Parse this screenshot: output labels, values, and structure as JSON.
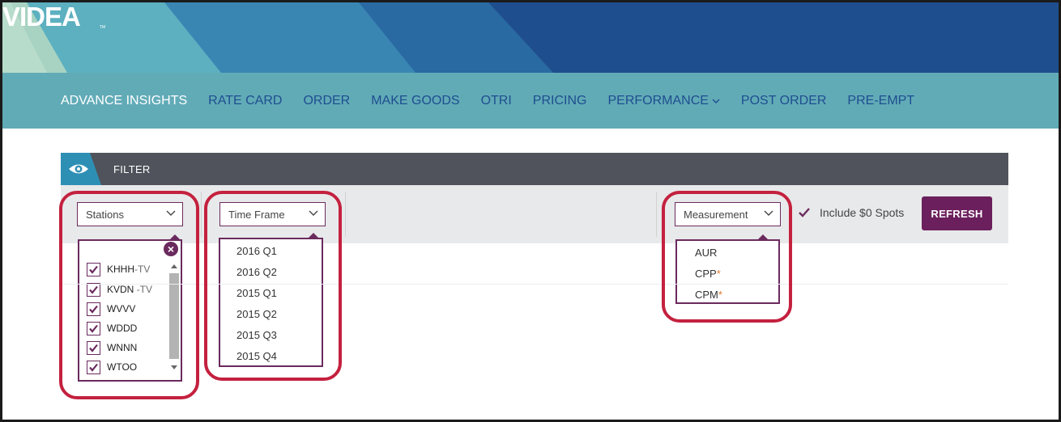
{
  "brand": {
    "logo_text": "VIDEA",
    "trademark": "TM"
  },
  "nav": {
    "items": [
      {
        "label": "ADVANCE INSIGHTS",
        "active": true
      },
      {
        "label": "RATE CARD"
      },
      {
        "label": "ORDER"
      },
      {
        "label": "MAKE GOODS"
      },
      {
        "label": "OTRI"
      },
      {
        "label": "PRICING"
      },
      {
        "label": "PERFORMANCE",
        "has_dropdown": true
      },
      {
        "label": "POST ORDER"
      },
      {
        "label": "PRE-EMPT"
      }
    ]
  },
  "filter": {
    "title": "FILTER",
    "icon": "eye-icon",
    "stations": {
      "label": "Stations",
      "options": [
        {
          "call": "KHHH",
          "suffix": "-TV",
          "checked": true
        },
        {
          "call": "KVDN ",
          "suffix": "-TV",
          "checked": true
        },
        {
          "call": "WVVV",
          "suffix": "",
          "checked": true
        },
        {
          "call": "WDDD",
          "suffix": "",
          "checked": true
        },
        {
          "call": "WNNN",
          "suffix": "",
          "checked": true
        },
        {
          "call": "WTOO",
          "suffix": "",
          "checked": true
        }
      ]
    },
    "time_frame": {
      "label": "Time Frame",
      "options": [
        "2016 Q1",
        "2016 Q2",
        "2015 Q1",
        "2015 Q2",
        "2015 Q3",
        "2015 Q4"
      ]
    },
    "measurement": {
      "label": "Measurement",
      "options": [
        {
          "label": "AUR",
          "star": ""
        },
        {
          "label": "CPP",
          "star": "*"
        },
        {
          "label": "CPM",
          "star": "*"
        }
      ]
    },
    "include_zero_spots": {
      "label": "Include $0 Spots",
      "checked": true
    },
    "refresh_label": "REFRESH"
  },
  "colors": {
    "banner_dark": "#1f4e8f",
    "nav_teal": "#61abb7",
    "accent_purple": "#6b2a5e",
    "highlight_red": "#c4213f"
  }
}
